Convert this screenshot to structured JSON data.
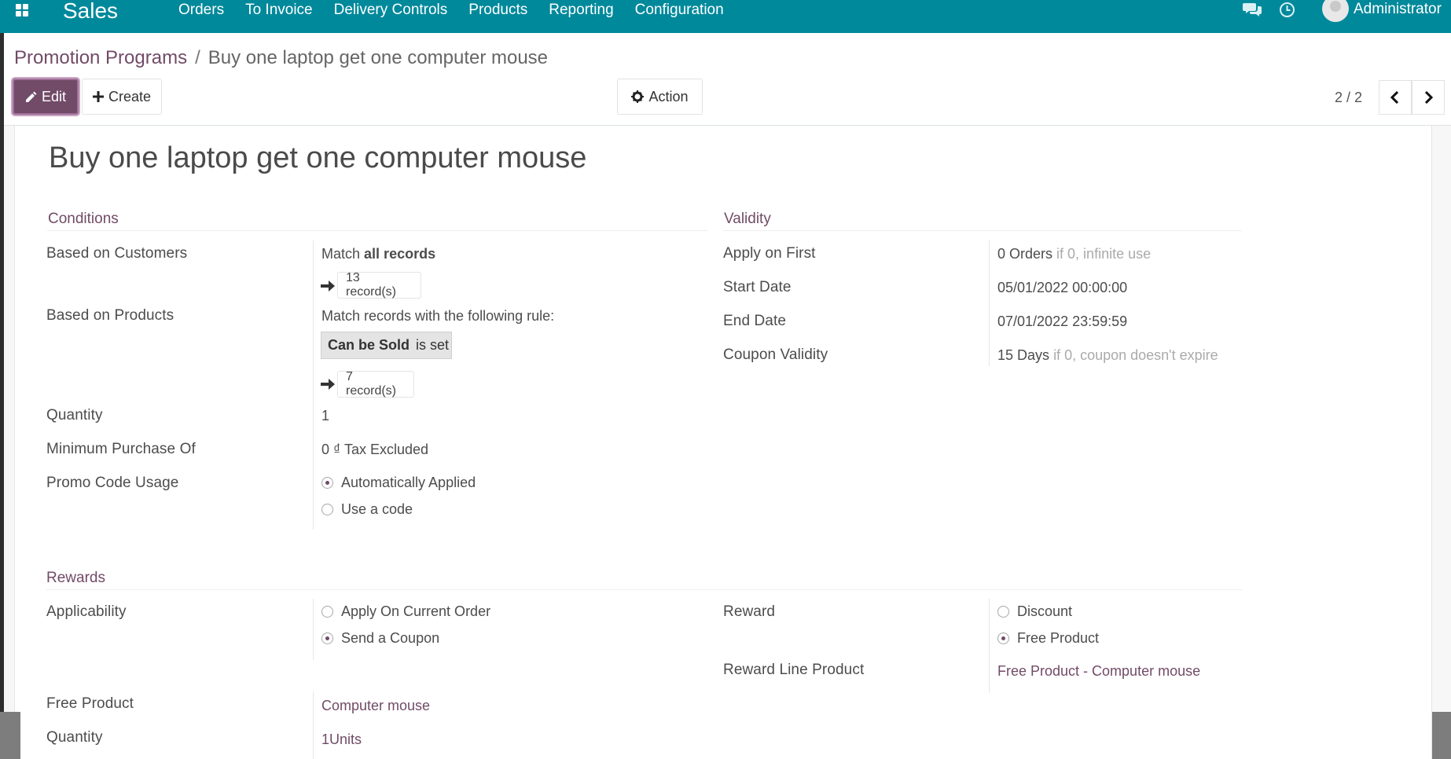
{
  "navbar": {
    "brand": "Sales",
    "menu": [
      "Orders",
      "To Invoice",
      "Delivery Controls",
      "Products",
      "Reporting",
      "Configuration"
    ],
    "user": "Administrator",
    "color": "#00899b"
  },
  "control_panel": {
    "breadcrumb_parent": "Promotion Programs",
    "breadcrumb_separator": "/",
    "breadcrumb_current": "Buy one laptop get one computer mouse",
    "edit_label": "Edit",
    "create_label": "Create",
    "action_label": "Action",
    "pager": "2 / 2"
  },
  "record": {
    "title": "Buy one laptop get one computer mouse",
    "conditions": {
      "section_title": "Conditions",
      "based_on_customers_label": "Based on Customers",
      "customers_match_prefix": "Match",
      "customers_match_bold": "all records",
      "customers_records": "13 record(s)",
      "based_on_products_label": "Based on Products",
      "products_match_text": "Match records with the following rule:",
      "rule_field": "Can be Sold",
      "rule_operator": "is set",
      "products_records": "7 record(s)",
      "quantity_label": "Quantity",
      "quantity_value": "1",
      "minimum_purchase_label": "Minimum Purchase Of",
      "minimum_purchase_value": "0 ₫",
      "minimum_purchase_tax": "Tax Excluded",
      "promo_code_usage_label": "Promo Code Usage",
      "promo_options": [
        "Automatically Applied",
        "Use a code"
      ],
      "promo_selected": 0
    },
    "validity": {
      "section_title": "Validity",
      "apply_on_first_label": "Apply on First",
      "apply_on_first_value": "0 Orders",
      "apply_on_first_hint": "if 0, infinite use",
      "start_date_label": "Start Date",
      "start_date_value": "05/01/2022 00:00:00",
      "end_date_label": "End Date",
      "end_date_value": "07/01/2022 23:59:59",
      "coupon_validity_label": "Coupon Validity",
      "coupon_validity_value": "15 Days",
      "coupon_validity_hint": "if 0, coupon doesn't expire"
    },
    "rewards": {
      "section_title": "Rewards",
      "applicability_label": "Applicability",
      "applicability_options": [
        "Apply On Current Order",
        "Send a Coupon"
      ],
      "applicability_selected": 1,
      "reward_label": "Reward",
      "reward_options": [
        "Discount",
        "Free Product"
      ],
      "reward_selected": 1,
      "reward_line_product_label": "Reward Line Product",
      "reward_line_product_value": "Free Product - Computer mouse",
      "free_product_label": "Free Product",
      "free_product_value": "Computer mouse",
      "quantity_label": "Quantity",
      "quantity_value": "1Units"
    }
  },
  "colors": {
    "primary": "#714b67",
    "navbar": "#00899b"
  }
}
